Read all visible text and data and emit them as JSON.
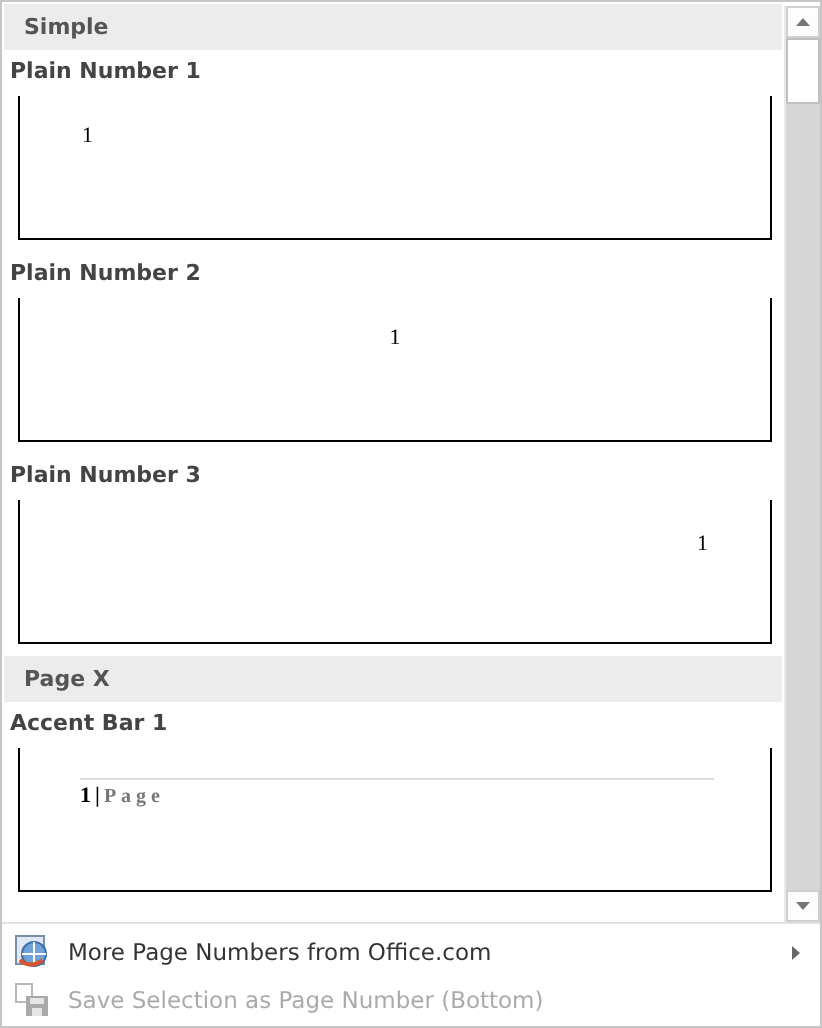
{
  "gallery": {
    "sections": [
      {
        "title": "Simple",
        "items": [
          {
            "title": "Plain Number 1",
            "kind": "left",
            "number": "1"
          },
          {
            "title": "Plain Number 2",
            "kind": "center",
            "number": "1"
          },
          {
            "title": "Plain Number 3",
            "kind": "right",
            "number": "1"
          }
        ]
      },
      {
        "title": "Page X",
        "items": [
          {
            "title": "Accent Bar 1",
            "kind": "accent",
            "number": "1",
            "separator": "|",
            "label": "Page"
          }
        ]
      }
    ]
  },
  "menu": [
    {
      "label": "More Page Numbers from Office.com",
      "kind": "web",
      "disabled": false,
      "submenu": true
    },
    {
      "label": "Save Selection as Page Number (Bottom)",
      "kind": "save",
      "disabled": true,
      "submenu": false
    }
  ]
}
